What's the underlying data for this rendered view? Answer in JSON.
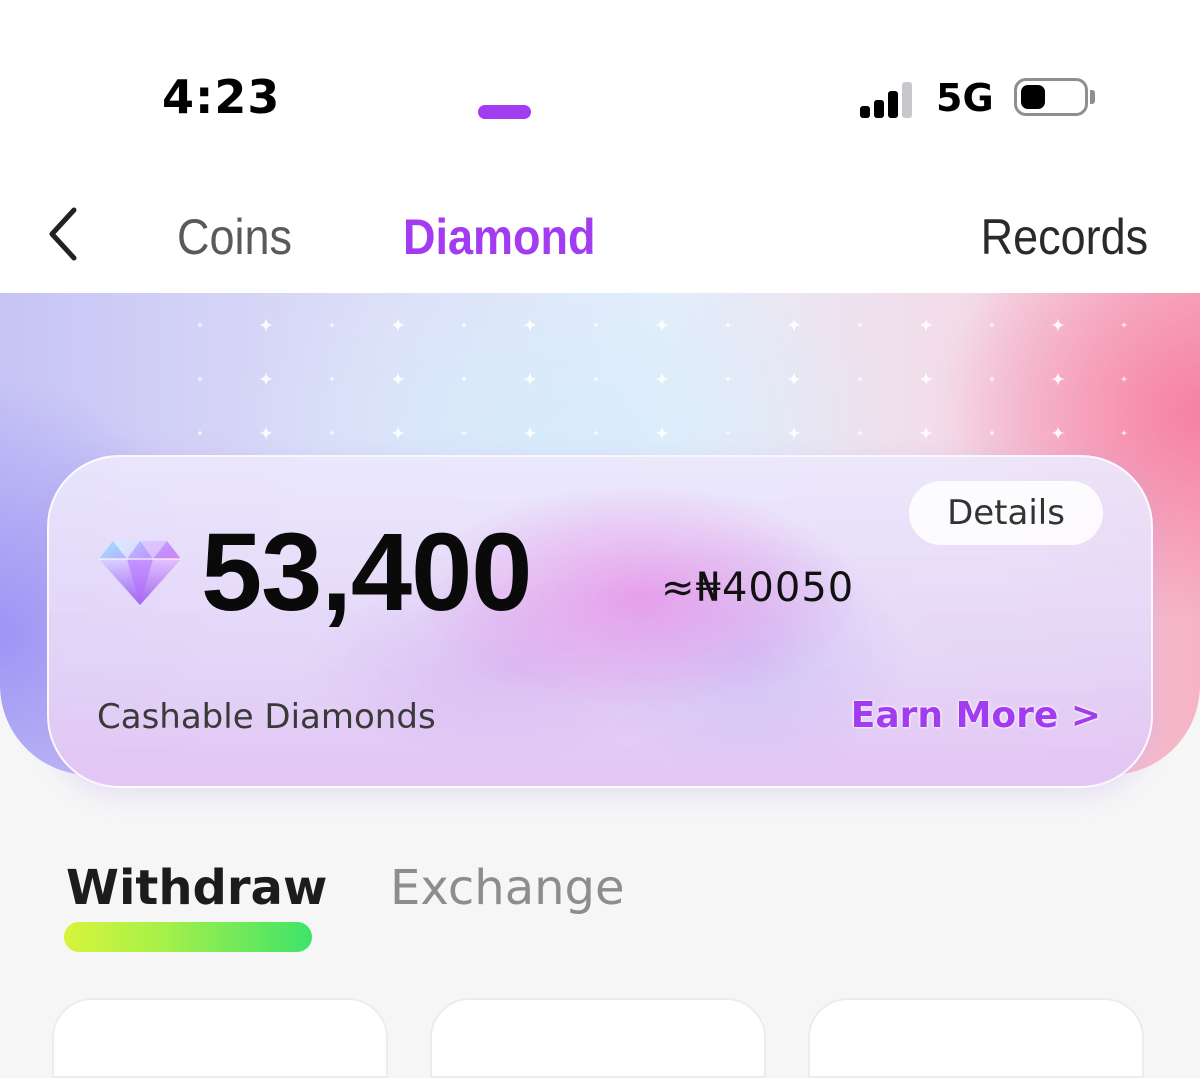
{
  "status_bar": {
    "time": "4:23",
    "network": "5G",
    "signal_bars_active": 3,
    "signal_bars_total": 4,
    "battery_level": 0.3
  },
  "nav": {
    "back_icon": "chevron-left-icon",
    "tabs": [
      {
        "label": "Coins",
        "active": false
      },
      {
        "label": "Diamond",
        "active": true
      }
    ],
    "records_label": "Records",
    "accent_color": "#a33cf0"
  },
  "balance": {
    "icon": "diamond-icon",
    "amount": "53,400",
    "equivalent": "≈₦40050",
    "details_label": "Details",
    "caption": "Cashable Diamonds",
    "earn_more_label": "Earn More >"
  },
  "sub_tabs": [
    {
      "label": "Withdraw",
      "active": true
    },
    {
      "label": "Exchange",
      "active": false
    }
  ],
  "colors": {
    "indicator_gradient_start": "#d6f53a",
    "indicator_gradient_end": "#3ee36a",
    "earn_more": "#a33cf0"
  }
}
